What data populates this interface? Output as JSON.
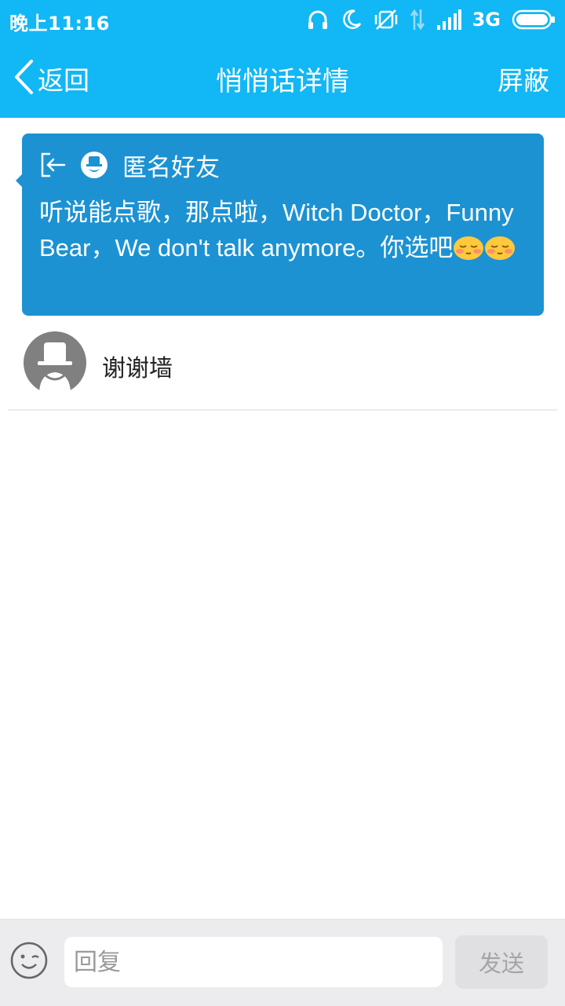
{
  "status": {
    "time": "晚上11:16",
    "network": "3G",
    "icons": [
      "headphones-icon",
      "moon-icon",
      "vibrate-off-icon",
      "data-arrows-icon",
      "signal-icon",
      "battery-icon"
    ]
  },
  "header": {
    "back_label": "返回",
    "title": "悄悄话详情",
    "action_label": "屏蔽",
    "background": "#12b7f5"
  },
  "message": {
    "sender": "匿名好友",
    "text": "听说能点歌，那点啦，Witch Doctor，Funny Bear，We don't talk anymore。你选吧",
    "emojis": [
      "blush-emoji",
      "blush-emoji"
    ],
    "background": "#1c92d3"
  },
  "comments": [
    {
      "text": "谢谢墙",
      "avatar": "anonymous-avatar"
    }
  ],
  "composer": {
    "placeholder": "回复",
    "send_label": "发送"
  }
}
